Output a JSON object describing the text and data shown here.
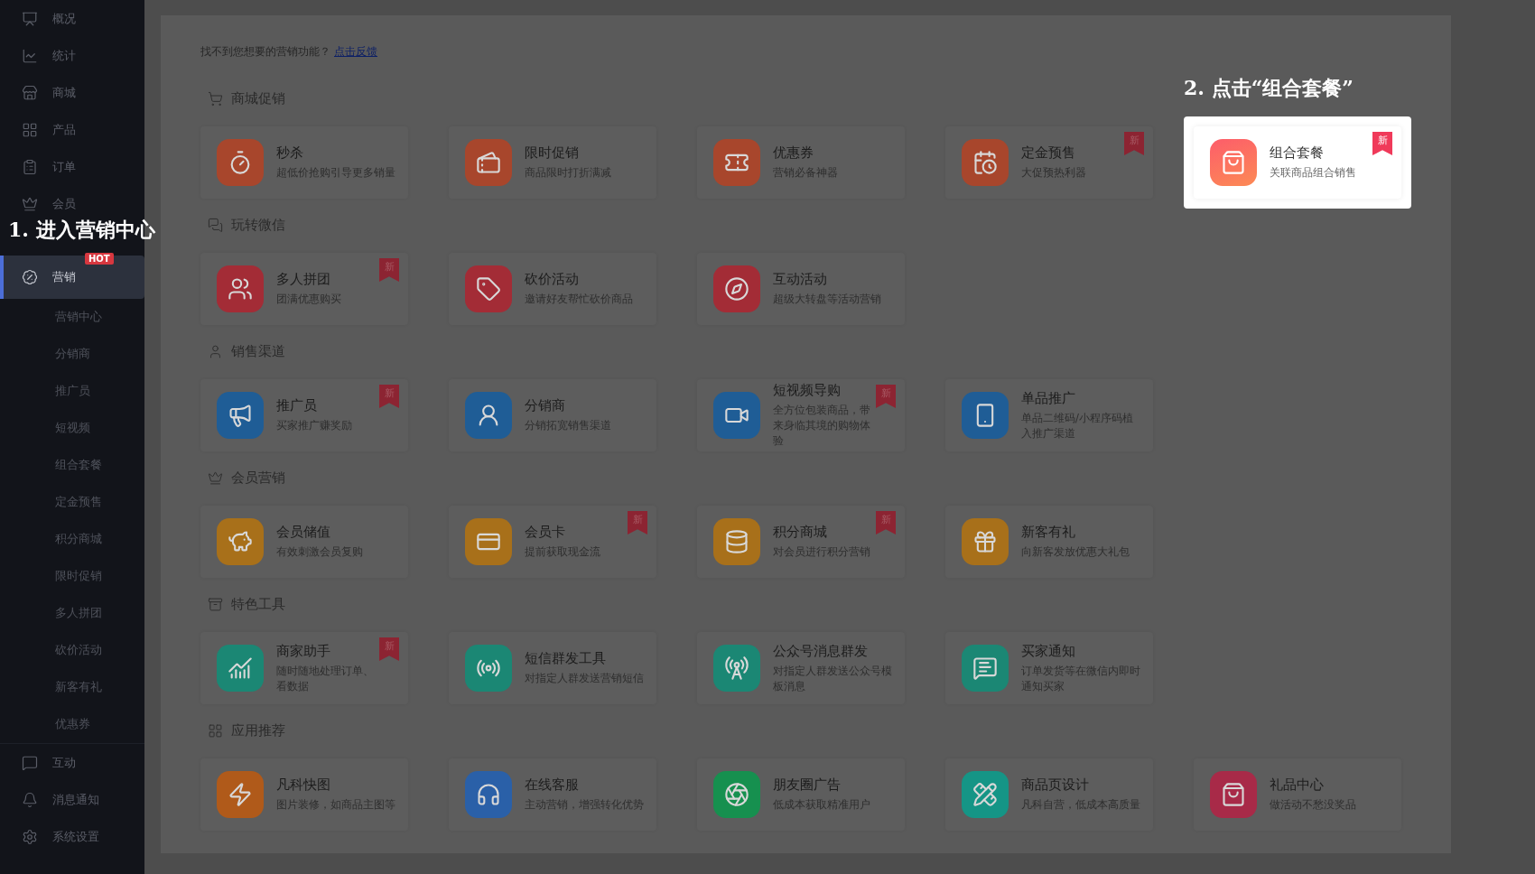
{
  "sidebar": {
    "items": [
      {
        "label": "概况",
        "selected": false
      },
      {
        "label": "统计",
        "selected": false
      },
      {
        "label": "商城",
        "selected": false
      },
      {
        "label": "产品",
        "selected": false
      },
      {
        "label": "订单",
        "selected": false
      },
      {
        "label": "会员",
        "selected": false
      },
      {
        "label": "营销",
        "selected": true,
        "badge": "HOT",
        "expanded": true,
        "children": [
          {
            "label": "营销中心"
          },
          {
            "label": "分销商"
          },
          {
            "label": "推广员"
          },
          {
            "label": "短视频"
          },
          {
            "label": "组合套餐"
          },
          {
            "label": "定金预售"
          },
          {
            "label": "积分商城"
          },
          {
            "label": "限时促销"
          },
          {
            "label": "多人拼团"
          },
          {
            "label": "砍价活动"
          },
          {
            "label": "新客有礼"
          },
          {
            "label": "优惠券"
          }
        ]
      },
      {
        "label": "互动",
        "selected": false
      },
      {
        "label": "消息通知",
        "selected": false
      },
      {
        "label": "系统设置",
        "selected": false
      }
    ]
  },
  "feedback": {
    "text": "找不到您想要的营销功能？",
    "link": "点击反馈"
  },
  "sections": [
    {
      "title": "商城促销",
      "items": [
        {
          "title": "秒杀",
          "desc": "超低价抢购引导更多销量",
          "color": "#a8462c",
          "highlighted": false
        },
        {
          "title": "限时促销",
          "desc": "商品限时打折满减",
          "color": "#a8462c",
          "highlighted": false
        },
        {
          "title": "优惠券",
          "desc": "营销必备神器",
          "color": "#a8462c",
          "highlighted": false
        },
        {
          "title": "定金预售",
          "desc": "大促预热利器",
          "color": "#a8462c",
          "badge": "新",
          "highlighted": false
        },
        {
          "title": "组合套餐",
          "desc": "关联商品组合销售",
          "color": "#fd5d6a",
          "badge": "新",
          "highlighted": true
        }
      ]
    },
    {
      "title": "玩转微信",
      "items": [
        {
          "title": "多人拼团",
          "desc": "团满优惠购买",
          "color": "#a32c36",
          "badge": "新",
          "highlighted": false
        },
        {
          "title": "砍价活动",
          "desc": "邀请好友帮忙砍价商品",
          "color": "#a32c36",
          "highlighted": false
        },
        {
          "title": "互动活动",
          "desc": "超级大转盘等活动营销",
          "color": "#a32c36",
          "highlighted": false
        }
      ]
    },
    {
      "title": "销售渠道",
      "items": [
        {
          "title": "推广员",
          "desc": "买家推广赚奖励",
          "color": "#1f5d96",
          "badge": "新",
          "highlighted": false
        },
        {
          "title": "分销商",
          "desc": "分销拓宽销售渠道",
          "color": "#1f5d96",
          "highlighted": false
        },
        {
          "title": "短视频导购",
          "desc": "全方位包装商品，带来身临其境的购物体验",
          "color": "#1f5d96",
          "badge": "新",
          "highlighted": false
        },
        {
          "title": "单品推广",
          "desc": "单品二维码/小程序码植入推广渠道",
          "color": "#1f5d96",
          "highlighted": false
        }
      ]
    },
    {
      "title": "会员营销",
      "items": [
        {
          "title": "会员储值",
          "desc": "有效刺激会员复购",
          "color": "#a8701a",
          "highlighted": false
        },
        {
          "title": "会员卡",
          "desc": "提前获取现金流",
          "color": "#a8701a",
          "badge": "新",
          "highlighted": false
        },
        {
          "title": "积分商城",
          "desc": "对会员进行积分营销",
          "color": "#a8701a",
          "badge": "新",
          "highlighted": false
        },
        {
          "title": "新客有礼",
          "desc": "向新客发放优惠大礼包",
          "color": "#a8701a",
          "highlighted": false
        }
      ]
    },
    {
      "title": "特色工具",
      "items": [
        {
          "title": "商家助手",
          "desc": "随时随地处理订单、看数据",
          "color": "#1b8774",
          "badge": "新",
          "highlighted": false
        },
        {
          "title": "短信群发工具",
          "desc": "对指定人群发送营销短信",
          "color": "#1b8774",
          "highlighted": false
        },
        {
          "title": "公众号消息群发",
          "desc": "对指定人群发送公众号模板消息",
          "color": "#1b8774",
          "highlighted": false
        },
        {
          "title": "买家通知",
          "desc": "订单发货等在微信内即时通知买家",
          "color": "#1b8774",
          "highlighted": false
        }
      ]
    },
    {
      "title": "应用推荐",
      "items": [
        {
          "title": "凡科快图",
          "desc": "图片装修，如商品主图等",
          "color": "#b05a1a",
          "highlighted": false
        },
        {
          "title": "在线客服",
          "desc": "主动营销，增强转化优势",
          "color": "#2a60a8",
          "highlighted": false
        },
        {
          "title": "朋友圈广告",
          "desc": "低成本获取精准用户",
          "color": "#16904f",
          "highlighted": false
        },
        {
          "title": "商品页设计",
          "desc": "凡科自营，低成本高质量",
          "color": "#159586",
          "highlighted": false
        },
        {
          "title": "礼品中心",
          "desc": "做活动不愁没奖品",
          "color": "#a82a48",
          "highlighted": false
        }
      ]
    }
  ],
  "annotations": [
    {
      "text": "1. 进入营销中心"
    },
    {
      "text": "2. 点击“组合套餐”"
    }
  ]
}
